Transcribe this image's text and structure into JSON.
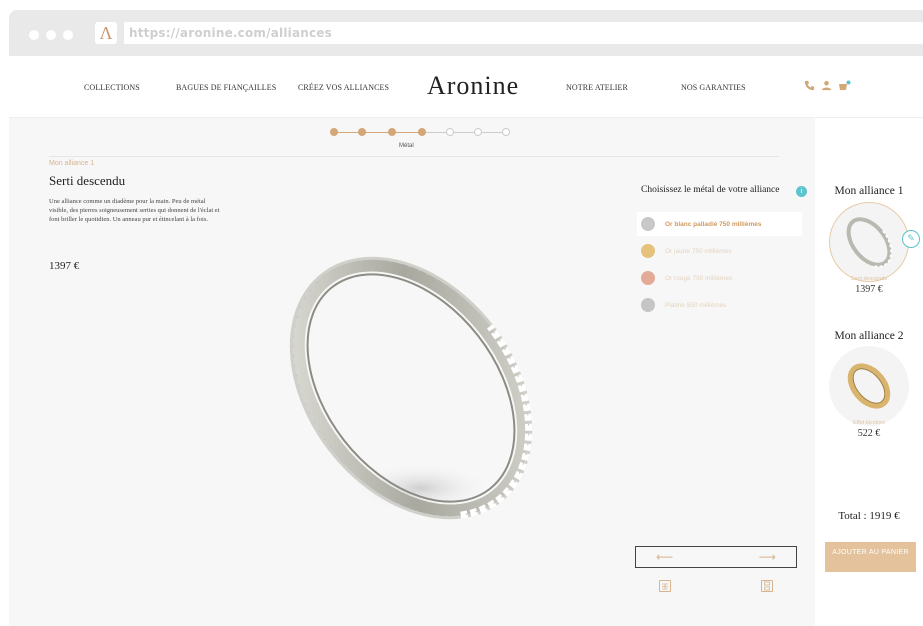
{
  "browser": {
    "url": "https://aronine.com/alliances",
    "favicon": "Λ"
  },
  "header": {
    "nav": [
      "COLLECTIONS",
      "BAGUES DE FIANÇAILLES",
      "CRÉEZ VOS ALLIANCES",
      "NOTRE ATELIER",
      "NOS GARANTIES"
    ],
    "logo": "Aronine",
    "icons": [
      "phone-icon",
      "user-icon",
      "cart-icon"
    ]
  },
  "stepper": {
    "total_steps": 7,
    "completed_steps": 4,
    "current_label": "Métal"
  },
  "product": {
    "eyebrow": "Mon alliance 1",
    "title": "Serti descendu",
    "description": "Une alliance comme un diadème pour la main. Peu de métal visible, des pierres soigneusement serties qui donnent de l'éclat et font briller le quotidien. Un anneau pur et étincelant à la fois.",
    "price": "1397 €"
  },
  "metal_panel": {
    "title": "Choisissez le métal de votre alliance",
    "info_icon": "i",
    "options": [
      {
        "label": "Or blanc palladié 750 millièmes",
        "color": "#c8c8c8",
        "active": true
      },
      {
        "label": "Or jaune 750 millièmes",
        "color": "#e5c27c",
        "active": false
      },
      {
        "label": "Or rouge 750 millièmes",
        "color": "#e4aa98",
        "active": false
      },
      {
        "label": "Platine 950 millièmes",
        "color": "#c5c5c5",
        "active": false
      }
    ],
    "prev_arrow": "⟵",
    "next_arrow": "⟶"
  },
  "sidebar": {
    "alliance1": {
      "title": "Mon alliance 1",
      "subtitle": "Serti descendu",
      "price": "1397 €"
    },
    "alliance2": {
      "title": "Mon alliance 2",
      "subtitle": "Effet bicolore",
      "price": "522 €"
    },
    "total": "Total : 1919 €",
    "cart_button": "AJOUTER AU PANIER"
  },
  "colors": {
    "accent_gold": "#d4a777",
    "accent_teal": "#5cc3cf",
    "cart_button": "#e3c29c"
  }
}
